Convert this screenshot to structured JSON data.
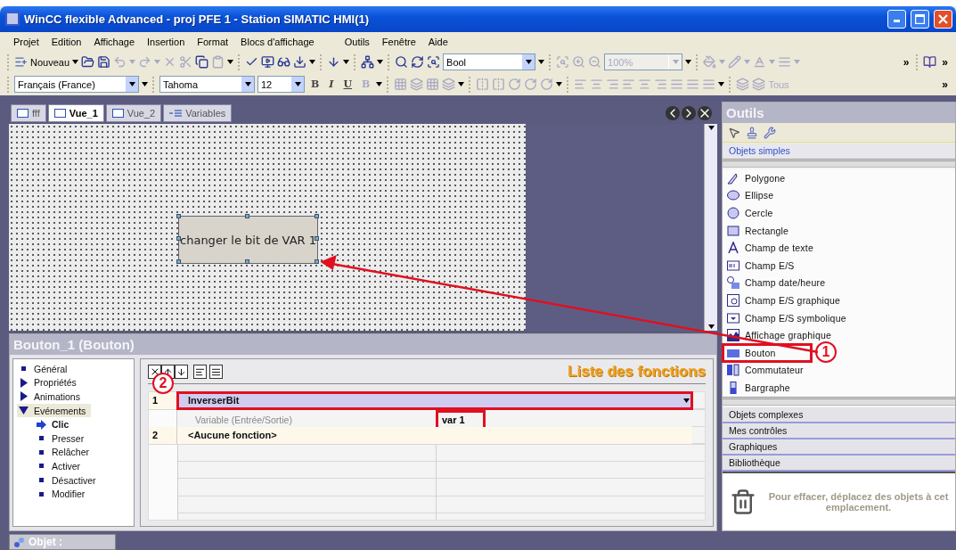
{
  "window": {
    "title": "WinCC flexible Advanced - proj PFE 1 - Station SIMATIC HMI(1)"
  },
  "menu": [
    "Projet",
    "Edition",
    "Affichage",
    "Insertion",
    "Format",
    "Blocs d'affichage",
    "Outils",
    "Fenêtre",
    "Aide"
  ],
  "toolbar_1": {
    "new_label": "Nouveau",
    "variable_combo": "Bool",
    "zoom_combo": {
      "value": "100%",
      "disabled": true
    },
    "overflow": [
      "»",
      "»"
    ]
  },
  "toolbar_2": {
    "language_combo": "Français (France)",
    "font_combo": "Tahoma",
    "size_combo": "12",
    "style_buttons": [
      {
        "label": "B",
        "disabled": false
      },
      {
        "label": "I",
        "disabled": false
      },
      {
        "label": "U",
        "disabled": false
      },
      {
        "label": "B",
        "disabled": true
      }
    ],
    "layer_label": "Tous",
    "overflow": "»"
  },
  "tabs": [
    {
      "label": "fff",
      "kind": "screen",
      "selected": false
    },
    {
      "label": "Vue_1",
      "kind": "screen",
      "selected": true
    },
    {
      "label": "Vue_2",
      "kind": "screen",
      "selected": false
    },
    {
      "label": "Variables",
      "kind": "tags",
      "selected": false
    }
  ],
  "canvas": {
    "button_text": "changer le bit de VAR 1",
    "selected": true
  },
  "properties": {
    "title": "Bouton_1 (Bouton)",
    "list_title": "Liste des fonctions",
    "tree": [
      {
        "label": "Général",
        "kind": "leaf",
        "selected": false
      },
      {
        "label": "Propriétés",
        "kind": "group",
        "expanded": false,
        "selected": false
      },
      {
        "label": "Animations",
        "kind": "group",
        "expanded": false,
        "selected": false
      },
      {
        "label": "Evénements",
        "kind": "group",
        "expanded": true,
        "selected": false,
        "children": [
          {
            "label": "Clic",
            "selected": true
          },
          {
            "label": "Presser",
            "selected": false
          },
          {
            "label": "Relâcher",
            "selected": false
          },
          {
            "label": "Activer",
            "selected": false
          },
          {
            "label": "Désactiver",
            "selected": false
          },
          {
            "label": "Modifier",
            "selected": false
          }
        ]
      }
    ],
    "rows": [
      {
        "kind": "function",
        "number": "1",
        "name": "InverserBit",
        "selected": true,
        "highlighted": true,
        "callout": "2"
      },
      {
        "kind": "parameter",
        "name": "Variable (Entrée/Sortie)",
        "value": "var 1",
        "highlighted": true
      },
      {
        "kind": "function",
        "number": "2",
        "name": "<Aucune fonction>",
        "selected": false,
        "highlighted": false
      }
    ]
  },
  "tools": {
    "title": "Outils",
    "section": "Objets simples",
    "items": [
      {
        "label": "Polygone",
        "kind": "polygon",
        "highlighted": false
      },
      {
        "label": "Ellipse",
        "kind": "ellipse",
        "highlighted": false
      },
      {
        "label": "Cercle",
        "kind": "circle",
        "highlighted": false
      },
      {
        "label": "Rectangle",
        "kind": "rectangle",
        "highlighted": false
      },
      {
        "label": "Champ de texte",
        "kind": "text",
        "highlighted": false
      },
      {
        "label": "Champ E/S",
        "kind": "io",
        "highlighted": false
      },
      {
        "label": "Champ date/heure",
        "kind": "datetime",
        "highlighted": false
      },
      {
        "label": "Champ E/S graphique",
        "kind": "graphic-io",
        "highlighted": false
      },
      {
        "label": "Champ E/S symbolique",
        "kind": "symbolic-io",
        "highlighted": false
      },
      {
        "label": "Affichage graphique",
        "kind": "graphic",
        "highlighted": false
      },
      {
        "label": "Bouton",
        "kind": "button",
        "highlighted": true,
        "callout": "1"
      },
      {
        "label": "Commutateur",
        "kind": "switch",
        "highlighted": false
      },
      {
        "label": "Bargraphe",
        "kind": "bar",
        "highlighted": false
      }
    ],
    "categories": [
      "Objets complexes",
      "Mes contrôles",
      "Graphiques",
      "Bibliothèque"
    ],
    "trash_hint": "Pour effacer, déplacez des objets à cet emplacement."
  },
  "status": {
    "object_tab": "Objet :"
  }
}
